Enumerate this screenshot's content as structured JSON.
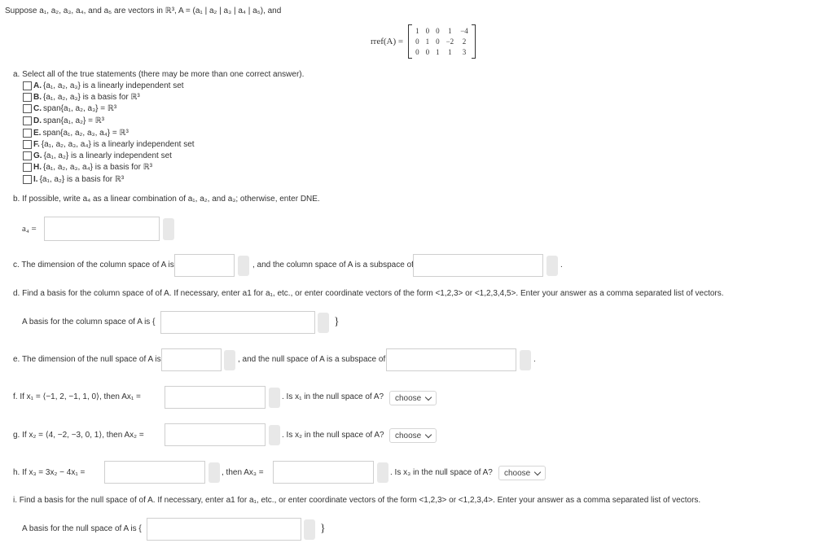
{
  "intro": "Suppose a₁, a₂, a₃, a₄, and a₅ are vectors in ℝ³, A = (a₁ | a₂ | a₃ | a₄ | a₅), and",
  "rref": {
    "label": "rref(A) =",
    "rows": [
      [
        "1",
        "0",
        "0",
        "1",
        "−4"
      ],
      [
        "0",
        "1",
        "0",
        "−2",
        "2"
      ],
      [
        "0",
        "0",
        "1",
        "1",
        "3"
      ]
    ]
  },
  "part_a": {
    "prompt": "a. Select all of the true statements (there may be more than one correct answer).",
    "options": [
      {
        "letter": "A.",
        "text": "{a₁, a₂, a₃} is a linearly independent set"
      },
      {
        "letter": "B.",
        "text": "{a₁, a₂, a₃} is a basis for ℝ³"
      },
      {
        "letter": "C.",
        "text": "span{a₁, a₂, a₃} = ℝ³"
      },
      {
        "letter": "D.",
        "text": "span{a₁, a₂} = ℝ³"
      },
      {
        "letter": "E.",
        "text": "span{a₁, a₂, a₃, a₄} = ℝ³"
      },
      {
        "letter": "F.",
        "text": "{a₁, a₂, a₃, a₄} is a linearly independent set"
      },
      {
        "letter": "G.",
        "text": "{a₁, a₂} is a linearly independent set"
      },
      {
        "letter": "H.",
        "text": "{a₁, a₂, a₃, a₄} is a basis for ℝ³"
      },
      {
        "letter": "I.",
        "text": "{a₁, a₂} is a basis for ℝ³"
      }
    ]
  },
  "part_b": {
    "prompt": "b. If possible, write a₄ as a linear combination of a₁, a₂, and a₃; otherwise, enter DNE.",
    "label": "a₄ ="
  },
  "part_c": {
    "prefix": "c. The dimension of the column space of A is",
    "middle": ", and the column space of A is a subspace of",
    "suffix": "."
  },
  "part_d": {
    "prompt": "d. Find a basis for the column space of of A. If necessary, enter a1 for a₁, etc., or enter coordinate vectors of the form <1,2,3> or <1,2,3,4,5>. Enter your answer as a comma separated list of vectors.",
    "label": "A basis for the column space of A is {",
    "close": "}"
  },
  "part_e": {
    "prefix": "e. The dimension of the null space of A is",
    "middle": ", and the null space of A is a subspace of",
    "suffix": "."
  },
  "part_f": {
    "prefix": "f. If x₁ = ⟨−1, 2, −1, 1, 0⟩, then Ax₁ =",
    "question": ". Is x₁ in the null space of A?",
    "select": "choose"
  },
  "part_g": {
    "prefix": "g. If x₂ = ⟨4, −2, −3, 0, 1⟩, then Ax₂ =",
    "question": ". Is x₂ in the null space of A?",
    "select": "choose"
  },
  "part_h": {
    "prefix": "h. If x₃ = 3x₂ − 4x₁ =",
    "middle": ", then Ax₃ =",
    "question": ". Is x₃ in the null space of A?",
    "select": "choose"
  },
  "part_i": {
    "prompt": "i. Find a basis for the null space of of A. If necessary, enter a1 for a₁, etc., or enter coordinate vectors of the form <1,2,3> or <1,2,3,4>. Enter your answer as a comma separated list of vectors.",
    "label": "A basis for the null space of A is {",
    "close": "}"
  }
}
